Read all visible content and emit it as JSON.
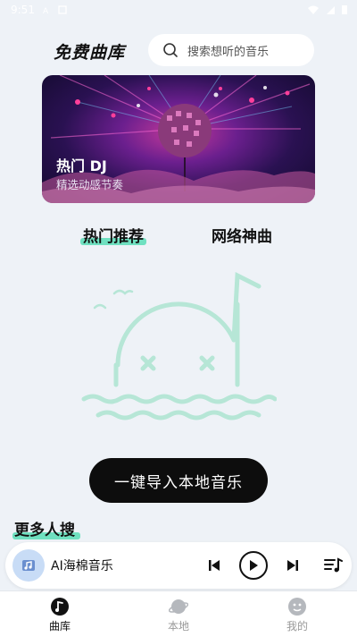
{
  "status_bar": {
    "time": "9:51"
  },
  "header": {
    "title": "免费曲库",
    "search_placeholder": "搜索想听的音乐"
  },
  "banner": {
    "title": "热门 DJ",
    "subtitle": "精选动感节奏"
  },
  "tabs": [
    {
      "label": "热门推荐",
      "active": true
    },
    {
      "label": "网络神曲",
      "active": false
    }
  ],
  "import_button_label": "一键导入本地音乐",
  "more_section_title": "更多人搜",
  "player": {
    "track_title": "AI海棉音乐",
    "icons": [
      "music-note-icon",
      "prev-icon",
      "play-icon",
      "next-icon",
      "playlist-icon"
    ]
  },
  "bottom_nav": [
    {
      "label": "曲库",
      "icon": "music-note-icon",
      "active": true
    },
    {
      "label": "本地",
      "icon": "planet-icon",
      "active": false
    },
    {
      "label": "我的",
      "icon": "face-icon",
      "active": false
    }
  ],
  "colors": {
    "accent_highlight": "#6fe0c0",
    "illustration": "#b6e6d6",
    "background": "#eef2f7",
    "button_dark": "#0d0d0d"
  }
}
